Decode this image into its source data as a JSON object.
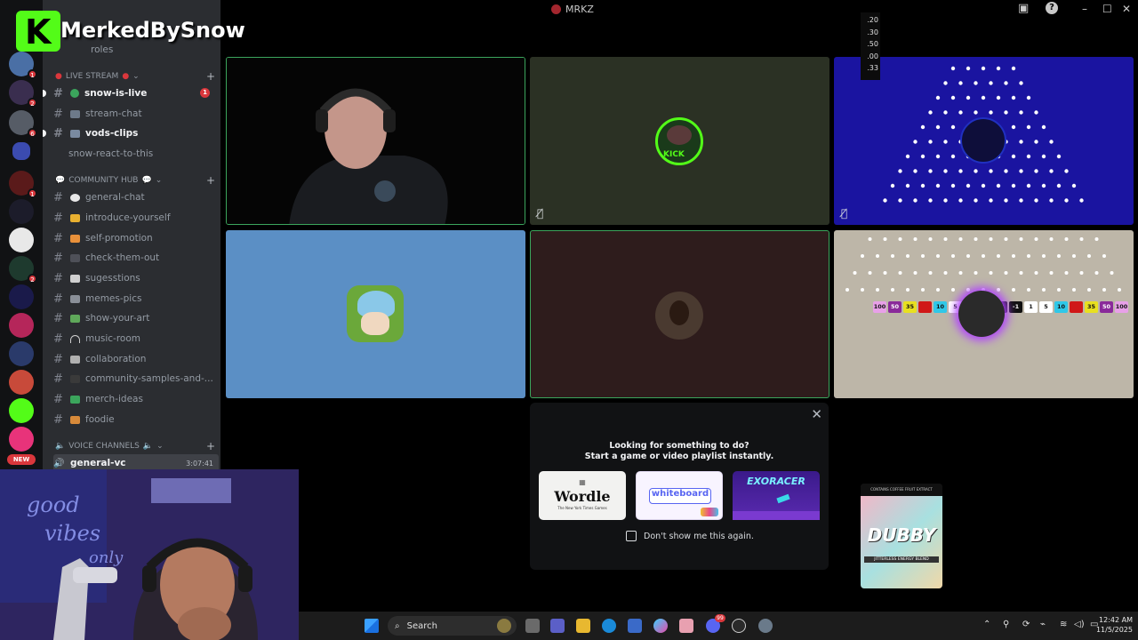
{
  "window": {
    "title": "MRKZ"
  },
  "overlay": {
    "streamer_name": "MerkedBySnow",
    "logo_letter": "K"
  },
  "odds": [
    ".20",
    ".30",
    ".50",
    ".00",
    ".33"
  ],
  "channels": {
    "partial_top": "roles",
    "categories": [
      {
        "label": "LIVE STREAM"
      },
      {
        "label": "COMMUNITY HUB"
      },
      {
        "label": "VOICE CHANNELS"
      }
    ],
    "items": [
      {
        "label": "snow-is-live",
        "badge": "1"
      },
      {
        "label": "stream-chat"
      },
      {
        "label": "vods-clips"
      },
      {
        "label": "snow-react-to-this"
      },
      {
        "label": "general-chat"
      },
      {
        "label": "introduce-yourself"
      },
      {
        "label": "self-promotion"
      },
      {
        "label": "check-them-out"
      },
      {
        "label": "sugesstions"
      },
      {
        "label": "memes-pics"
      },
      {
        "label": "show-your-art"
      },
      {
        "label": "music-room"
      },
      {
        "label": "collaboration"
      },
      {
        "label": "community-samples-and-..."
      },
      {
        "label": "merch-ideas"
      },
      {
        "label": "foodie"
      }
    ],
    "voice": {
      "label": "general-vc",
      "timer": "3:07:41"
    }
  },
  "servers": {
    "badges": [
      "1",
      "2",
      "6",
      "1",
      "2"
    ],
    "new_label": "NEW"
  },
  "tiles": {
    "kick_label": "KICK",
    "plinko_values": [
      "100",
      "50",
      "35",
      "",
      "10",
      "5",
      "1",
      "-1",
      "-2",
      "-1",
      "1",
      "5",
      "10",
      "",
      "35",
      "50",
      "100"
    ]
  },
  "activities": {
    "heading": "Looking for something to do?",
    "subheading": "Start a game or video playlist instantly.",
    "cards": [
      {
        "label": "Wordle",
        "sub": "The New York Times Games"
      },
      {
        "label": "whiteboard"
      },
      {
        "label": "EXORACER"
      }
    ],
    "dont_show": "Don't show me this again."
  },
  "ad": {
    "top": "CONTAINS COFFEE FRUIT EXTRACT",
    "brand": "DUBBY",
    "line": "JITTERLESS ENERGY BLEND"
  },
  "taskbar": {
    "search_label": "Search",
    "time": "12:42 AM",
    "date": "11/5/2025",
    "notif_badge": "99"
  },
  "colors": {
    "speaking_border": "#3ba55c",
    "unread_badge": "#da373c",
    "kick_green": "#53fc18"
  }
}
